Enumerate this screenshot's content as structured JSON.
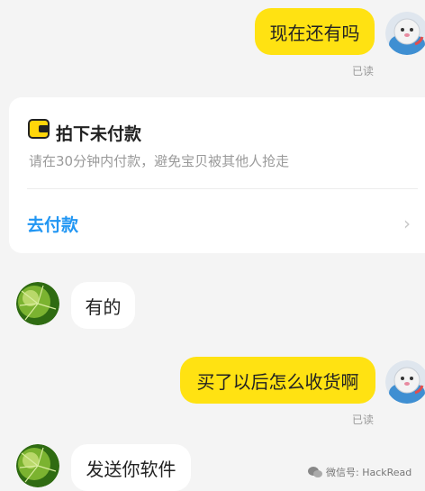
{
  "messages": [
    {
      "text": "现在还有吗",
      "status": "已读"
    },
    {
      "text": "有的"
    },
    {
      "text": "买了以后怎么收货啊",
      "status": "已读"
    },
    {
      "text": "发送你软件"
    }
  ],
  "order_card": {
    "title": "拍下未付款",
    "subtitle": "请在30分钟内付款，避免宝贝被其他人抢走",
    "action": "去付款",
    "icon": "wallet-icon",
    "chevron": "›"
  },
  "watermark": {
    "text": "微信号: HackRead",
    "icon": "wechat-icon"
  },
  "colors": {
    "my_bubble": "#ffe212",
    "their_bubble": "#ffffff",
    "accent": "#2196f3",
    "background": "#f4f4f4"
  }
}
